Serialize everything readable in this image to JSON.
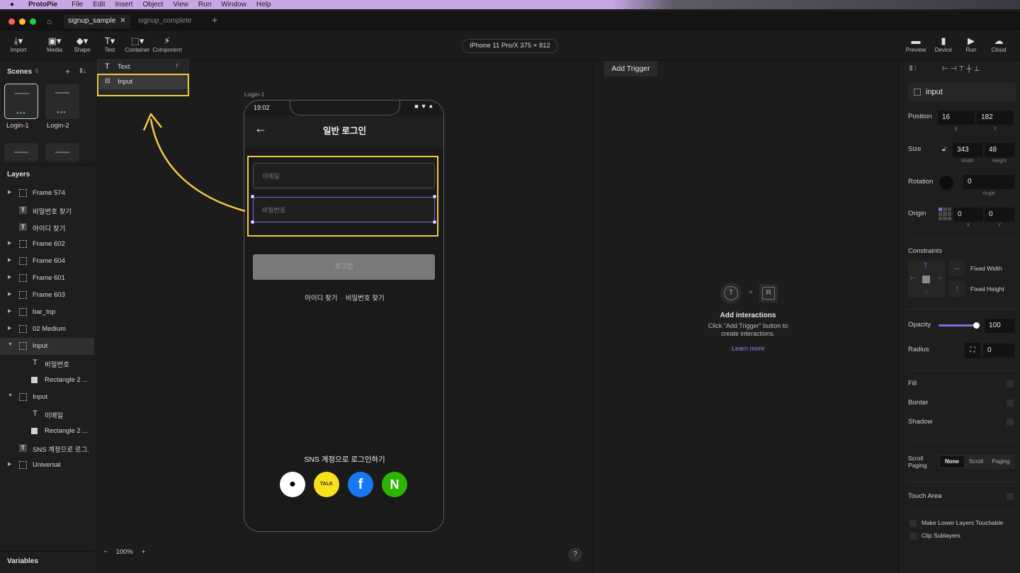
{
  "menubar": {
    "app_name": "ProtoPie",
    "items": [
      "File",
      "Edit",
      "Insert",
      "Object",
      "View",
      "Run",
      "Window",
      "Help"
    ]
  },
  "tabs": [
    {
      "label": "signup_sample",
      "active": true
    },
    {
      "label": "signup_complete",
      "active": false
    }
  ],
  "toolbar": {
    "tools": [
      {
        "label": "Import",
        "icon": "import-icon"
      },
      {
        "label": "Media",
        "icon": "media-icon"
      },
      {
        "label": "Shape",
        "icon": "shape-icon"
      },
      {
        "label": "Text",
        "icon": "text-icon"
      },
      {
        "label": "Container",
        "icon": "container-icon"
      },
      {
        "label": "Component",
        "icon": "component-icon"
      }
    ],
    "device": "iPhone 11 Pro/X  375 × 812",
    "right_tools": [
      {
        "label": "Preview",
        "icon": "preview-icon"
      },
      {
        "label": "Device",
        "icon": "device-icon"
      },
      {
        "label": "Run",
        "icon": "play-icon"
      },
      {
        "label": "Cloud",
        "icon": "cloud-icon"
      }
    ]
  },
  "scenes": {
    "title": "Scenes",
    "count": "5",
    "items": [
      {
        "label": "Login-1"
      },
      {
        "label": "Login-2"
      }
    ]
  },
  "dropdown": {
    "items": [
      {
        "label": "Text",
        "shortcut": "T"
      },
      {
        "label": "Input",
        "shortcut": ""
      }
    ]
  },
  "layers": {
    "title": "Layers",
    "items": [
      {
        "name": "Frame 574",
        "type": "frame",
        "expanded": false
      },
      {
        "name": "비밀번호 찾기",
        "type": "text"
      },
      {
        "name": "아이디 찾기",
        "type": "text"
      },
      {
        "name": "Frame 602",
        "type": "frame",
        "expanded": false
      },
      {
        "name": "Frame 604",
        "type": "frame",
        "expanded": false
      },
      {
        "name": "Frame 601",
        "type": "frame",
        "expanded": false
      },
      {
        "name": "Frame 603",
        "type": "frame",
        "expanded": false
      },
      {
        "name": "bar_top",
        "type": "frame",
        "expanded": false
      },
      {
        "name": "02 Medium",
        "type": "frame",
        "expanded": false
      },
      {
        "name": "Input",
        "type": "frame",
        "expanded": true,
        "selected": true
      },
      {
        "name": "비밀번호",
        "type": "tglyph",
        "child": true
      },
      {
        "name": "Rectangle 2 ...",
        "type": "rect",
        "child": true
      },
      {
        "name": "Input",
        "type": "frame",
        "expanded": true
      },
      {
        "name": "이메일",
        "type": "tglyph",
        "child": true
      },
      {
        "name": "Rectangle 2 ...",
        "type": "rect",
        "child": true
      },
      {
        "name": "SNS 계정으로 로그...",
        "type": "text"
      },
      {
        "name": "Universal",
        "type": "frame",
        "expanded": false
      }
    ]
  },
  "variables_title": "Variables",
  "canvas": {
    "scene_label": "Login-1",
    "zoom": "100%",
    "phone": {
      "time": "19:02",
      "title": "일반 로그인",
      "email_placeholder": "이메일",
      "password_placeholder": "비밀번호",
      "login_button": "로그인",
      "find_id": "아이디 찾기",
      "find_pw": "비밀번호 찾기",
      "sns_label": "SNS 계정으로 로그인하기",
      "sns": [
        {
          "name": "apple",
          "glyph": "",
          "bg": "#ffffff",
          "fg": "#000000"
        },
        {
          "name": "kakao",
          "glyph": "TALK",
          "bg": "#f7e01c",
          "fg": "#3a2929"
        },
        {
          "name": "facebook",
          "glyph": "f",
          "bg": "#1877f2",
          "fg": "#ffffff"
        },
        {
          "name": "naver",
          "glyph": "N",
          "bg": "#2db400",
          "fg": "#ffffff"
        }
      ]
    }
  },
  "interactions": {
    "add_trigger": "Add Trigger",
    "title": "Add interactions",
    "desc": "Click \"Add Trigger\" button to create interactions.",
    "link": "Learn more",
    "t_glyph": "T",
    "plus": "+",
    "r_glyph": "R"
  },
  "properties": {
    "layer_name": "input",
    "position": {
      "label": "Position",
      "x": "16",
      "y": "182",
      "x_label": "X",
      "y_label": "Y"
    },
    "size": {
      "label": "Size",
      "w": "343",
      "h": "48",
      "w_label": "Width",
      "h_label": "Height"
    },
    "rotation": {
      "label": "Rotation",
      "value": "0",
      "sub": "Angle"
    },
    "origin": {
      "label": "Origin",
      "x": "0",
      "y": "0",
      "x_label": "X",
      "y_label": "Y"
    },
    "constraints": {
      "label": "Constraints",
      "fixed_width": "Fixed Width",
      "fixed_height": "Fixed Height"
    },
    "opacity": {
      "label": "Opacity",
      "value": "100"
    },
    "radius": {
      "label": "Radius",
      "value": "0"
    },
    "fill": "Fill",
    "border": "Border",
    "shadow": "Shadow",
    "scroll_paging": {
      "label": "Scroll Paging",
      "options": [
        "None",
        "Scroll",
        "Paging"
      ],
      "selected": "None"
    },
    "touch_area": "Touch Area",
    "make_lower": "Make Lower Layers Touchable",
    "clip": "Clip Sublayers"
  },
  "colors": {
    "highlight": "#f4c842",
    "accent": "#7a6be0"
  }
}
